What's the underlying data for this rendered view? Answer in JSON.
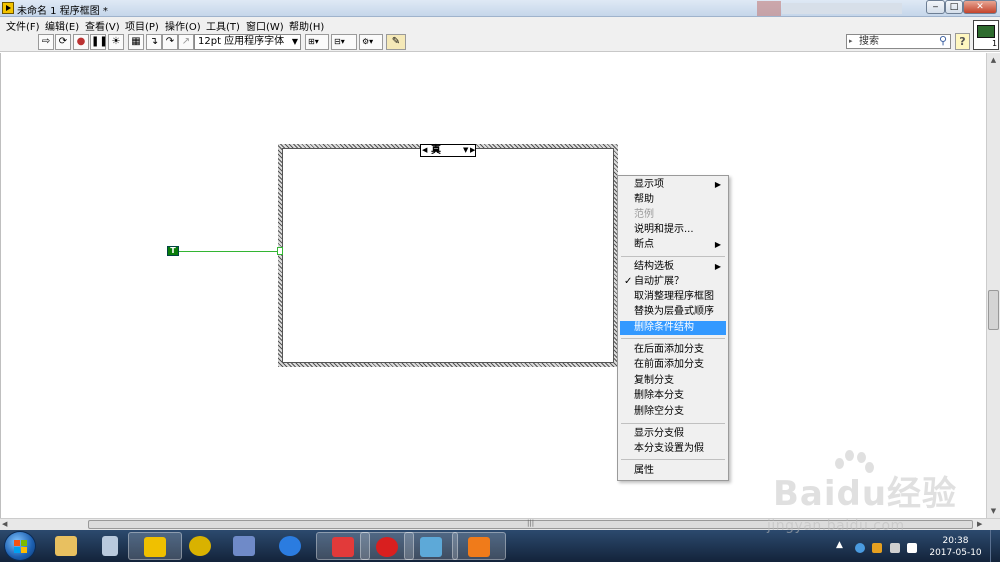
{
  "window": {
    "title": "未命名 1 程序框图 *",
    "controls": {
      "minimize": "‒",
      "maximize": "□",
      "close": "✕"
    }
  },
  "menu": [
    "文件(F)",
    "编辑(E)",
    "查看(V)",
    "项目(P)",
    "操作(O)",
    "工具(T)",
    "窗口(W)",
    "帮助(H)"
  ],
  "toolbar": {
    "font_select": "12pt 应用程序字体",
    "search_placeholder": "搜索",
    "help_label": "?",
    "vi_icon_number": "1"
  },
  "diagram": {
    "case_selector_value": "真",
    "bool_constant": "T"
  },
  "context_menu": {
    "items": [
      {
        "label": "显示项",
        "submenu": true
      },
      {
        "label": "帮助"
      },
      {
        "label": "范例",
        "disabled": true
      },
      {
        "label": "说明和提示..."
      },
      {
        "label": "断点",
        "submenu": true
      },
      {
        "label": "结构选板",
        "submenu": true
      },
      {
        "label": "自动扩展？",
        "checked": true
      },
      {
        "label": "取消整理程序框图"
      },
      {
        "label": "替换为层叠式顺序"
      },
      {
        "label": "删除条件结构",
        "highlighted": true
      },
      {
        "label": "在后面添加分支"
      },
      {
        "label": "在前面添加分支"
      },
      {
        "label": "复制分支"
      },
      {
        "label": "删除本分支"
      },
      {
        "label": "删除空分支"
      },
      {
        "label": "显示分支假"
      },
      {
        "label": "本分支设置为假"
      },
      {
        "label": "属性"
      }
    ]
  },
  "taskbar": {
    "clock_time": "20:38",
    "clock_date": "2017-05-10",
    "tray_arrow": "▲"
  },
  "watermark": {
    "brand": "Baidu经验",
    "url": "jingyan.baidu.com"
  },
  "colors": {
    "menu_highlight": "#3399ff",
    "bool_green": "#0a7d0a",
    "taskbar": "#1b3350"
  }
}
